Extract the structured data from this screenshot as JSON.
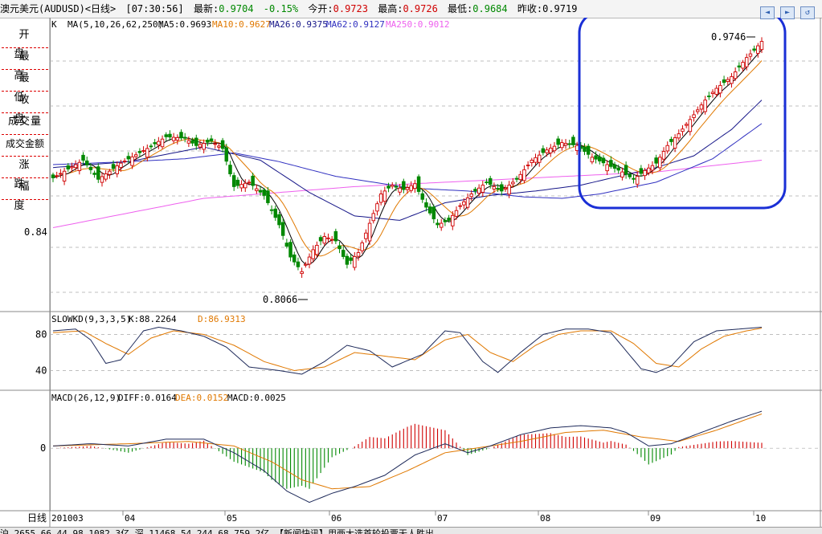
{
  "header": {
    "title": "澳元美元(AUDUSD)<日线>",
    "time": "[07:30:56]",
    "latest_label": "最新:",
    "latest": "0.9704",
    "change": "-0.15%",
    "open_label": "今开:",
    "open": "0.9723",
    "high_label": "最高:",
    "high": "0.9726",
    "low_label": "最低:",
    "low": "0.9684",
    "prev_label": "昨收:",
    "prev": "0.9719"
  },
  "sidebar": {
    "items": [
      "开盘",
      "最高",
      "最低",
      "收盘",
      "成交量",
      "成交金额",
      "涨跌",
      "幅度"
    ]
  },
  "legend": {
    "k_label": "K",
    "ma_params": "MA(5,10,26,62,250)",
    "ma5": "MA5:0.9693",
    "ma10": "MA10:0.9627",
    "ma26": "MA26:0.9375",
    "ma62": "MA62:0.9127",
    "ma250": "MA250:0.9012"
  },
  "kd_legend": {
    "name": "SLOWKD(9,3,3,5)",
    "k": "K:88.2264",
    "d": "D:86.9313"
  },
  "macd_legend": {
    "name": "MACD(26,12,9)",
    "diff": "DIFF:0.0164",
    "dea": "DEA:0.0152",
    "macd": "MACD:0.0025"
  },
  "annotations": {
    "high_label": "0.9746",
    "low_label": "0.8066"
  },
  "axis": {
    "period_label": "日线",
    "start_date": "201003"
  },
  "colors": {
    "up": "#d00000",
    "down": "#008800",
    "ma5": "#000000",
    "ma10": "#e07800",
    "ma26": "#161688",
    "ma62": "#3030c0",
    "ma250": "#ee60ee",
    "highlight": "#1a2fd6"
  },
  "bottom": "沪 2655.66 44.98 1082.3亿 深 11468.54 244.68 759.2亿 【新闻快讯】用两大选首轮投票无人胜出",
  "chart_data": {
    "type": "candlestick",
    "panels": [
      "price",
      "slowkd",
      "macd"
    ],
    "price_ticks": [
      0.84
    ],
    "kd_ticks": [
      80,
      40
    ],
    "macd_ticks": [
      0
    ],
    "x_labels": [
      "201003",
      "04",
      "05",
      "06",
      "07",
      "08",
      "09",
      "10"
    ],
    "price_anchors": [
      [
        0,
        0.877
      ],
      [
        8,
        0.889
      ],
      [
        12,
        0.876
      ],
      [
        18,
        0.887
      ],
      [
        25,
        0.897
      ],
      [
        30,
        0.905
      ],
      [
        35,
        0.904
      ],
      [
        38,
        0.899
      ],
      [
        42,
        0.902
      ],
      [
        45,
        0.897
      ],
      [
        48,
        0.871
      ],
      [
        52,
        0.874
      ],
      [
        56,
        0.865
      ],
      [
        60,
        0.845
      ],
      [
        63,
        0.823
      ],
      [
        66,
        0.813
      ],
      [
        69,
        0.828
      ],
      [
        72,
        0.837
      ],
      [
        75,
        0.834
      ],
      [
        78,
        0.818
      ],
      [
        81,
        0.826
      ],
      [
        84,
        0.846
      ],
      [
        87,
        0.866
      ],
      [
        90,
        0.872
      ],
      [
        93,
        0.869
      ],
      [
        96,
        0.873
      ],
      [
        99,
        0.857
      ],
      [
        102,
        0.845
      ],
      [
        105,
        0.848
      ],
      [
        108,
        0.858
      ],
      [
        111,
        0.866
      ],
      [
        115,
        0.874
      ],
      [
        119,
        0.868
      ],
      [
        123,
        0.876
      ],
      [
        127,
        0.889
      ],
      [
        131,
        0.896
      ],
      [
        135,
        0.901
      ],
      [
        139,
        0.899
      ],
      [
        143,
        0.891
      ],
      [
        147,
        0.886
      ],
      [
        151,
        0.881
      ],
      [
        154,
        0.876
      ],
      [
        157,
        0.882
      ],
      [
        160,
        0.887
      ],
      [
        163,
        0.899
      ],
      [
        166,
        0.907
      ],
      [
        170,
        0.92
      ],
      [
        173,
        0.93
      ],
      [
        176,
        0.938
      ],
      [
        180,
        0.946
      ],
      [
        184,
        0.959
      ],
      [
        186,
        0.964
      ],
      [
        188,
        0.97
      ]
    ],
    "ma26_anchors": [
      [
        0,
        0.884
      ],
      [
        20,
        0.888
      ],
      [
        40,
        0.898
      ],
      [
        55,
        0.889
      ],
      [
        68,
        0.867
      ],
      [
        80,
        0.851
      ],
      [
        92,
        0.848
      ],
      [
        104,
        0.86
      ],
      [
        116,
        0.865
      ],
      [
        128,
        0.868
      ],
      [
        140,
        0.872
      ],
      [
        150,
        0.878
      ],
      [
        160,
        0.884
      ],
      [
        170,
        0.892
      ],
      [
        180,
        0.91
      ],
      [
        188,
        0.93
      ]
    ],
    "ma62_anchors": [
      [
        0,
        0.886
      ],
      [
        20,
        0.888
      ],
      [
        35,
        0.89
      ],
      [
        48,
        0.894
      ],
      [
        60,
        0.888
      ],
      [
        75,
        0.878
      ],
      [
        95,
        0.87
      ],
      [
        110,
        0.868
      ],
      [
        125,
        0.864
      ],
      [
        135,
        0.863
      ],
      [
        145,
        0.866
      ],
      [
        160,
        0.874
      ],
      [
        175,
        0.89
      ],
      [
        188,
        0.914
      ]
    ],
    "ma250_anchors": [
      [
        0,
        0.843
      ],
      [
        40,
        0.863
      ],
      [
        80,
        0.871
      ],
      [
        120,
        0.876
      ],
      [
        160,
        0.881
      ],
      [
        188,
        0.889
      ]
    ],
    "kd_anchors": [
      [
        0,
        84
      ],
      [
        6,
        86
      ],
      [
        10,
        74
      ],
      [
        14,
        48
      ],
      [
        18,
        52
      ],
      [
        24,
        84
      ],
      [
        28,
        88
      ],
      [
        34,
        84
      ],
      [
        40,
        78
      ],
      [
        46,
        66
      ],
      [
        52,
        44
      ],
      [
        60,
        40
      ],
      [
        66,
        36
      ],
      [
        72,
        50
      ],
      [
        78,
        68
      ],
      [
        84,
        62
      ],
      [
        90,
        44
      ],
      [
        98,
        58
      ],
      [
        104,
        84
      ],
      [
        108,
        82
      ],
      [
        114,
        50
      ],
      [
        118,
        38
      ],
      [
        124,
        60
      ],
      [
        130,
        80
      ],
      [
        136,
        86
      ],
      [
        142,
        86
      ],
      [
        148,
        82
      ],
      [
        152,
        62
      ],
      [
        156,
        42
      ],
      [
        160,
        38
      ],
      [
        164,
        45
      ],
      [
        170,
        72
      ],
      [
        176,
        84
      ],
      [
        182,
        86
      ],
      [
        188,
        88
      ]
    ],
    "kd_d_anchors": [
      [
        0,
        82
      ],
      [
        8,
        84
      ],
      [
        14,
        70
      ],
      [
        20,
        58
      ],
      [
        26,
        76
      ],
      [
        32,
        84
      ],
      [
        40,
        80
      ],
      [
        48,
        68
      ],
      [
        56,
        50
      ],
      [
        64,
        40
      ],
      [
        72,
        44
      ],
      [
        80,
        60
      ],
      [
        88,
        56
      ],
      [
        96,
        52
      ],
      [
        104,
        74
      ],
      [
        110,
        80
      ],
      [
        116,
        60
      ],
      [
        122,
        50
      ],
      [
        128,
        68
      ],
      [
        134,
        80
      ],
      [
        140,
        84
      ],
      [
        148,
        84
      ],
      [
        154,
        70
      ],
      [
        160,
        48
      ],
      [
        166,
        44
      ],
      [
        172,
        64
      ],
      [
        178,
        78
      ],
      [
        184,
        84
      ],
      [
        188,
        87
      ]
    ],
    "macd_diff_anchors": [
      [
        0,
        0.001
      ],
      [
        10,
        0.002
      ],
      [
        20,
        0.001
      ],
      [
        30,
        0.004
      ],
      [
        40,
        0.004
      ],
      [
        48,
        -0.002
      ],
      [
        56,
        -0.01
      ],
      [
        62,
        -0.019
      ],
      [
        68,
        -0.024
      ],
      [
        74,
        -0.02
      ],
      [
        80,
        -0.017
      ],
      [
        88,
        -0.012
      ],
      [
        96,
        -0.003
      ],
      [
        104,
        0.002
      ],
      [
        110,
        -0.002
      ],
      [
        116,
        0.001
      ],
      [
        124,
        0.006
      ],
      [
        132,
        0.009
      ],
      [
        140,
        0.01
      ],
      [
        148,
        0.009
      ],
      [
        152,
        0.007
      ],
      [
        158,
        0.001
      ],
      [
        164,
        0.002
      ],
      [
        172,
        0.007
      ],
      [
        180,
        0.012
      ],
      [
        188,
        0.0164
      ]
    ],
    "macd_dea_anchors": [
      [
        0,
        0.001
      ],
      [
        20,
        0.002
      ],
      [
        36,
        0.003
      ],
      [
        48,
        0.001
      ],
      [
        58,
        -0.006
      ],
      [
        66,
        -0.014
      ],
      [
        74,
        -0.018
      ],
      [
        84,
        -0.017
      ],
      [
        94,
        -0.01
      ],
      [
        104,
        -0.002
      ],
      [
        112,
        0.0
      ],
      [
        124,
        0.003
      ],
      [
        136,
        0.007
      ],
      [
        146,
        0.008
      ],
      [
        156,
        0.005
      ],
      [
        166,
        0.003
      ],
      [
        176,
        0.008
      ],
      [
        188,
        0.0152
      ]
    ],
    "high_value": 0.9746,
    "low_value": 0.8066,
    "ylim_price": [
      0.788,
      0.984
    ],
    "ylim_kd": [
      20,
      100
    ],
    "ylim_macd": [
      -0.027,
      0.02
    ]
  }
}
